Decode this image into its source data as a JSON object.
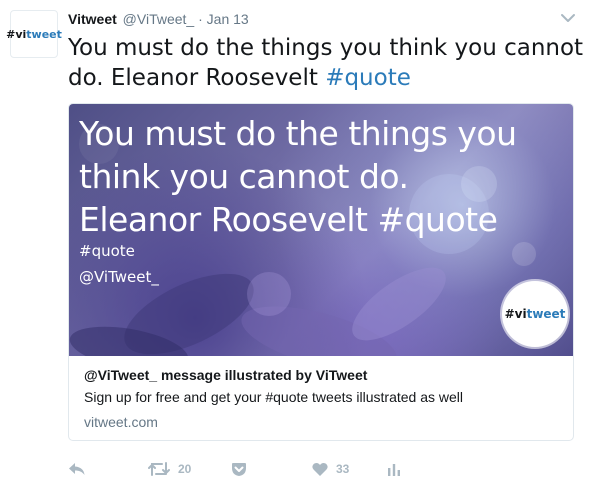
{
  "colors": {
    "link": "#2b7bb9",
    "secondary_text": "#657786",
    "action_icon": "#aab8c2",
    "card_border": "#e1e8ed"
  },
  "avatar": {
    "hash": "#vi",
    "tweet": "tweet",
    "icon": "vitweet-logo"
  },
  "header": {
    "name": "Vitweet",
    "handle": "@ViTweet_",
    "separator": "·",
    "date": "Jan 13"
  },
  "tweet": {
    "text": "You must do the things you think you cannot do. Eleanor Roosevelt ",
    "hashtag": "#quote"
  },
  "card": {
    "image": {
      "quote_text": "You must do the things you think you cannot do. Eleanor Roosevelt  #quote",
      "tag": "#quote",
      "user": "@ViTweet_",
      "badge_hash": "#vi",
      "badge_tweet": "tweet"
    },
    "title": "@ViTweet_ message illustrated by ViTweet",
    "description": "Sign up for free and get your #quote tweets illustrated as well",
    "url": "vitweet.com"
  },
  "actions": {
    "reply": {
      "icon": "reply-icon"
    },
    "retweet": {
      "icon": "retweet-icon",
      "count": "20"
    },
    "pocket": {
      "icon": "pocket-icon"
    },
    "like": {
      "icon": "heart-icon",
      "count": "33"
    },
    "analytics": {
      "icon": "analytics-icon"
    }
  },
  "caret": {
    "icon": "chevron-down-icon"
  }
}
